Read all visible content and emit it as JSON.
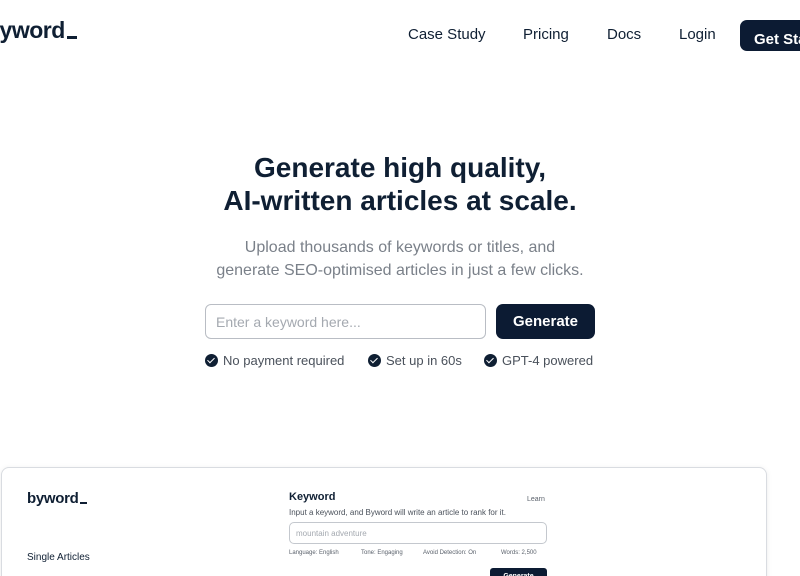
{
  "nav": {
    "logo": "byword",
    "links": [
      "Case Study",
      "Pricing",
      "Docs",
      "Login"
    ],
    "cta_label": "Get Started"
  },
  "hero": {
    "title_line1": "Generate high quality,",
    "title_line2": "AI-written articles at scale.",
    "subtitle_line1": "Upload thousands of keywords or titles, and",
    "subtitle_line2": "generate SEO-optimised articles in just a few clicks.",
    "input_placeholder": "Enter a keyword here...",
    "button_label": "Generate",
    "features": [
      "No payment required",
      "Set up in 60s",
      "GPT-4 powered"
    ]
  },
  "preview": {
    "logo": "byword",
    "sidebar_item": "Single Articles",
    "keyword_label": "Keyword",
    "learn_link": "Learn",
    "help_text": "Input a keyword, and Byword will write an article to rank for it.",
    "input_placeholder": "mountain adventure",
    "meta": [
      "Language: English",
      "Tone: Engaging",
      "Avoid Detection: On",
      "Words: 2,500"
    ],
    "button_label": "Generate"
  },
  "colors": {
    "brand_dark": "#0c1b33",
    "text_muted": "#7a8089"
  }
}
